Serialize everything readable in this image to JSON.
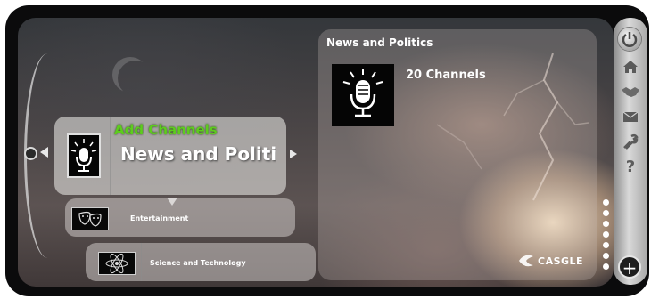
{
  "channel_list": {
    "add_channels_label": "Add Channels",
    "selected_category": "News and Politics",
    "items": [
      {
        "label": "Entertainment"
      },
      {
        "label": "Science and  Technology"
      }
    ]
  },
  "detail": {
    "title": "News and Politics",
    "channel_count": "20 Channels"
  },
  "brand": {
    "logo_text": "CASGLE"
  },
  "toolbar": {
    "plus_symbol": "+",
    "help_symbol": "?",
    "icons": [
      "power-icon",
      "home-icon",
      "handshake-icon",
      "mail-icon",
      "wrench-icon",
      "help-icon",
      "plus-icon"
    ]
  },
  "pagination": {
    "dot_count": 7
  },
  "colors": {
    "accent_green": "#5dcc1e",
    "frame": "#0b0b0c",
    "text": "#ffffff"
  }
}
